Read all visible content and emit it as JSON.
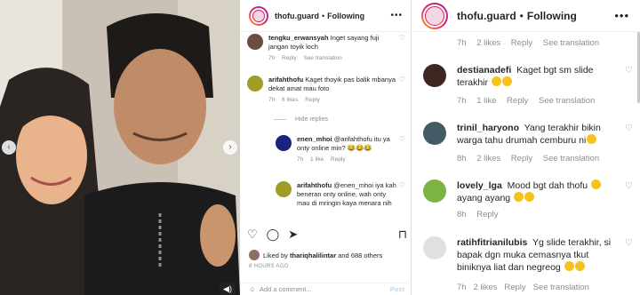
{
  "left": {
    "account": {
      "username": "thofu.guard",
      "follow": "Following",
      "dot": "•",
      "more": "•••"
    },
    "comments": [
      {
        "user": "tengku_erwansyah",
        "text": "Inget sayang fuji jangan toyik loch",
        "time": "7h",
        "reply": "Reply",
        "translate": "See translation",
        "avatar_color": "#6d4c41"
      },
      {
        "user": "arifahthofu",
        "text": "Kaget thoyik pas balik mbanya dekat amat mau foto",
        "time": "7h",
        "likes": "6 likes",
        "reply": "Reply",
        "avatar_color": "#9e9d24"
      }
    ],
    "hide_replies": "Hide replies",
    "replies": [
      {
        "user": "enen_mhoi",
        "text": "@arifahthofu itu ya onty online min? 😂😂😂",
        "time": "7h",
        "likes": "1 like",
        "reply": "Reply",
        "avatar_color": "#1a237e"
      },
      {
        "user": "arifahthofu",
        "text": "@enen_mhoi iya kah beneran onty online, wah onty mau di mringin kaya menara nih",
        "avatar_color": "#9e9d24"
      }
    ],
    "liked_by": {
      "prefix": "Liked by",
      "user": "thariqhalilintar",
      "suffix": "and 688 others"
    },
    "time_ago": "8 HOURS AGO",
    "add_comment": {
      "placeholder": "Add a comment...",
      "post": "Post"
    },
    "colors": {
      "accent": "#e91e63",
      "link": "#00376b"
    }
  },
  "right": {
    "account": {
      "username": "thofu.guard",
      "follow": "Following",
      "dot": "•",
      "more": "•••"
    },
    "top_meta": {
      "time": "7h",
      "likes": "2 likes",
      "reply": "Reply",
      "translate": "See translation"
    },
    "comments": [
      {
        "user": "destianadefi",
        "text": "Kaget bgt sm slide terakhir",
        "emoji_count": 2,
        "time": "7h",
        "likes": "1 like",
        "reply": "Reply",
        "translate": "See translation",
        "avatar_color": "#3e2723"
      },
      {
        "user": "trinil_haryono",
        "text": "Yang terakhir bikin warga tahu drumah cemburu ni",
        "emoji_count": 1,
        "time": "8h",
        "likes": "2 likes",
        "reply": "Reply",
        "translate": "See translation",
        "avatar_color": "#455a64"
      },
      {
        "user": "lovely_lga",
        "text": "Mood bgt dah thofu",
        "text2": "ayang ayang",
        "emoji_count": 2,
        "time": "8h",
        "reply": "Reply",
        "avatar_color": "#7cb342"
      },
      {
        "user": "ratihfitrianilubis",
        "text": "Yg slide terakhir, si bapak dgn muka cemasnya tkut biniknya liat dan negreog",
        "emoji_count": 2,
        "avatar_color": "#e0e0e0"
      }
    ],
    "bottom_meta": {
      "time": "7h",
      "likes": "2 likes",
      "reply": "Reply",
      "translate": "See translation"
    }
  }
}
